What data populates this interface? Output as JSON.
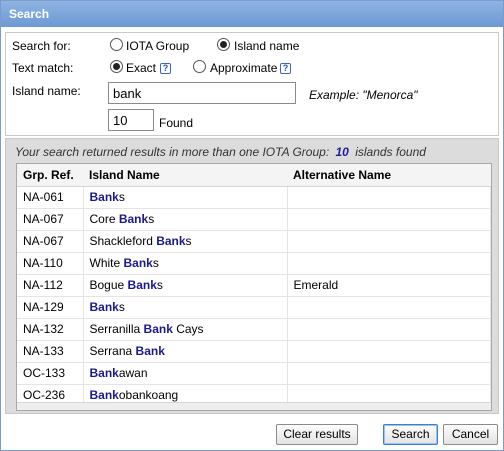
{
  "window": {
    "title": "Search"
  },
  "form": {
    "search_for_label": "Search for:",
    "search_for_options": [
      {
        "label": "IOTA Group",
        "checked": false
      },
      {
        "label": "Island name",
        "checked": true
      }
    ],
    "text_match_label": "Text match:",
    "text_match_options": [
      {
        "label": "Exact",
        "checked": true
      },
      {
        "label": "Approximate",
        "checked": false
      }
    ],
    "help_glyph": "?",
    "island_name_label": "Island name:",
    "island_name_value": "bank",
    "example_text": "Example: \"Menorca\"",
    "found_count_value": "10",
    "found_label": "Found"
  },
  "results": {
    "summary_prefix": "Your search returned results in more than one IOTA Group:",
    "summary_count": "10",
    "summary_suffix": "islands found",
    "columns": [
      "Grp. Ref.",
      "Island Name",
      "Alternative Name"
    ],
    "rows": [
      {
        "ref": "NA-061",
        "name": [
          {
            "t": "Bank",
            "h": true
          },
          {
            "t": "s",
            "h": false
          }
        ],
        "alt": ""
      },
      {
        "ref": "NA-067",
        "name": [
          {
            "t": "Core ",
            "h": false
          },
          {
            "t": "Bank",
            "h": true
          },
          {
            "t": "s",
            "h": false
          }
        ],
        "alt": ""
      },
      {
        "ref": "NA-067",
        "name": [
          {
            "t": "Shackleford ",
            "h": false
          },
          {
            "t": "Bank",
            "h": true
          },
          {
            "t": "s",
            "h": false
          }
        ],
        "alt": ""
      },
      {
        "ref": "NA-110",
        "name": [
          {
            "t": "White ",
            "h": false
          },
          {
            "t": "Bank",
            "h": true
          },
          {
            "t": "s",
            "h": false
          }
        ],
        "alt": ""
      },
      {
        "ref": "NA-112",
        "name": [
          {
            "t": "Bogue ",
            "h": false
          },
          {
            "t": "Bank",
            "h": true
          },
          {
            "t": "s",
            "h": false
          }
        ],
        "alt": "Emerald"
      },
      {
        "ref": "NA-129",
        "name": [
          {
            "t": "Bank",
            "h": true
          },
          {
            "t": "s",
            "h": false
          }
        ],
        "alt": ""
      },
      {
        "ref": "NA-132",
        "name": [
          {
            "t": "Serranilla ",
            "h": false
          },
          {
            "t": "Bank",
            "h": true
          },
          {
            "t": " Cays",
            "h": false
          }
        ],
        "alt": ""
      },
      {
        "ref": "NA-133",
        "name": [
          {
            "t": "Serrana ",
            "h": false
          },
          {
            "t": "Bank",
            "h": true
          }
        ],
        "alt": ""
      },
      {
        "ref": "OC-133",
        "name": [
          {
            "t": "Bank",
            "h": true
          },
          {
            "t": "awan",
            "h": false
          }
        ],
        "alt": ""
      },
      {
        "ref": "OC-236",
        "name": [
          {
            "t": "Bank",
            "h": true
          },
          {
            "t": "obankoang",
            "h": false
          }
        ],
        "alt": ""
      }
    ]
  },
  "buttons": {
    "clear": "Clear results",
    "search": "Search",
    "cancel": "Cancel"
  },
  "colors": {
    "title_bar": "#7aa3da",
    "highlight_text": "#1a1a8e",
    "results_background": "#dcdcdc"
  }
}
